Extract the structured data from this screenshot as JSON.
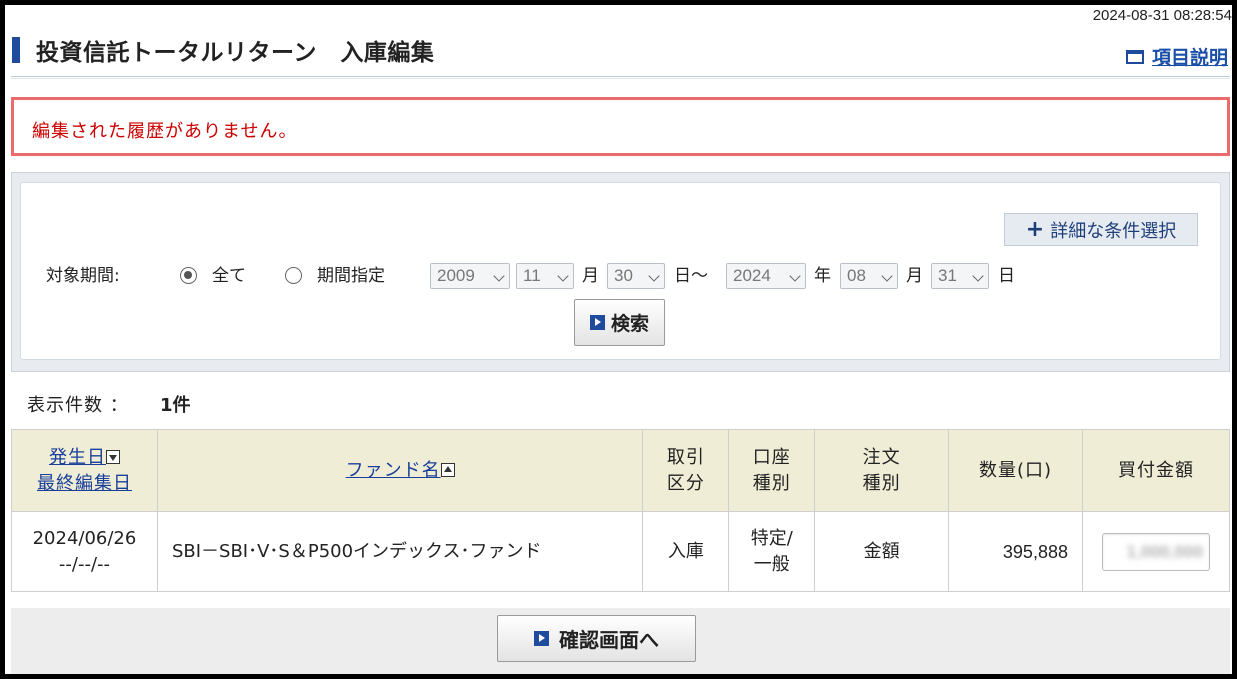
{
  "header": {
    "timestamp": "2024-08-31 08:28:54",
    "title": "投資信託トータルリターン　入庫編集",
    "help_link": "項目説明"
  },
  "message": {
    "error": "編集された履歴がありません。"
  },
  "search": {
    "detail_button": "詳細な条件選択",
    "period_label": "対象期間:",
    "option_all": "全て",
    "option_range": "期間指定",
    "selected_option": "全て",
    "from_year": "2009",
    "from_month": "11",
    "from_day": "30",
    "to_year": "2024",
    "to_month": "08",
    "to_day": "31",
    "unit_month": "月",
    "unit_day_tilde": "日～",
    "unit_year": "年",
    "unit_day": "日",
    "search_button": "検索"
  },
  "results": {
    "count_label": "表示件数 ：",
    "count_value": "1件",
    "columns": {
      "date_line1": "発生日",
      "date_line2": "最終編集日",
      "fund": "ファンド名",
      "trade_1": "取引",
      "trade_2": "区分",
      "account_1": "口座",
      "account_2": "種別",
      "order_1": "注文",
      "order_2": "種別",
      "quantity": "数量(口)",
      "amount": "買付金額"
    },
    "rows": [
      {
        "date": "2024/06/26",
        "edited": "--/--/--",
        "fund": "SBI－SBI･V･S＆P500インデックス･ファンド",
        "trade": "入庫",
        "account_1": "特定/",
        "account_2": "一般",
        "order": "金額",
        "quantity": "395,888",
        "amount": "1,000,000"
      }
    ]
  },
  "footer": {
    "confirm_button": "確認画面へ"
  },
  "colors": {
    "accent": "#1f4b9c",
    "link": "#1a4fa8",
    "error": "#cc0000",
    "error_border": "#ee6b6b",
    "table_header": "#efedd6"
  }
}
